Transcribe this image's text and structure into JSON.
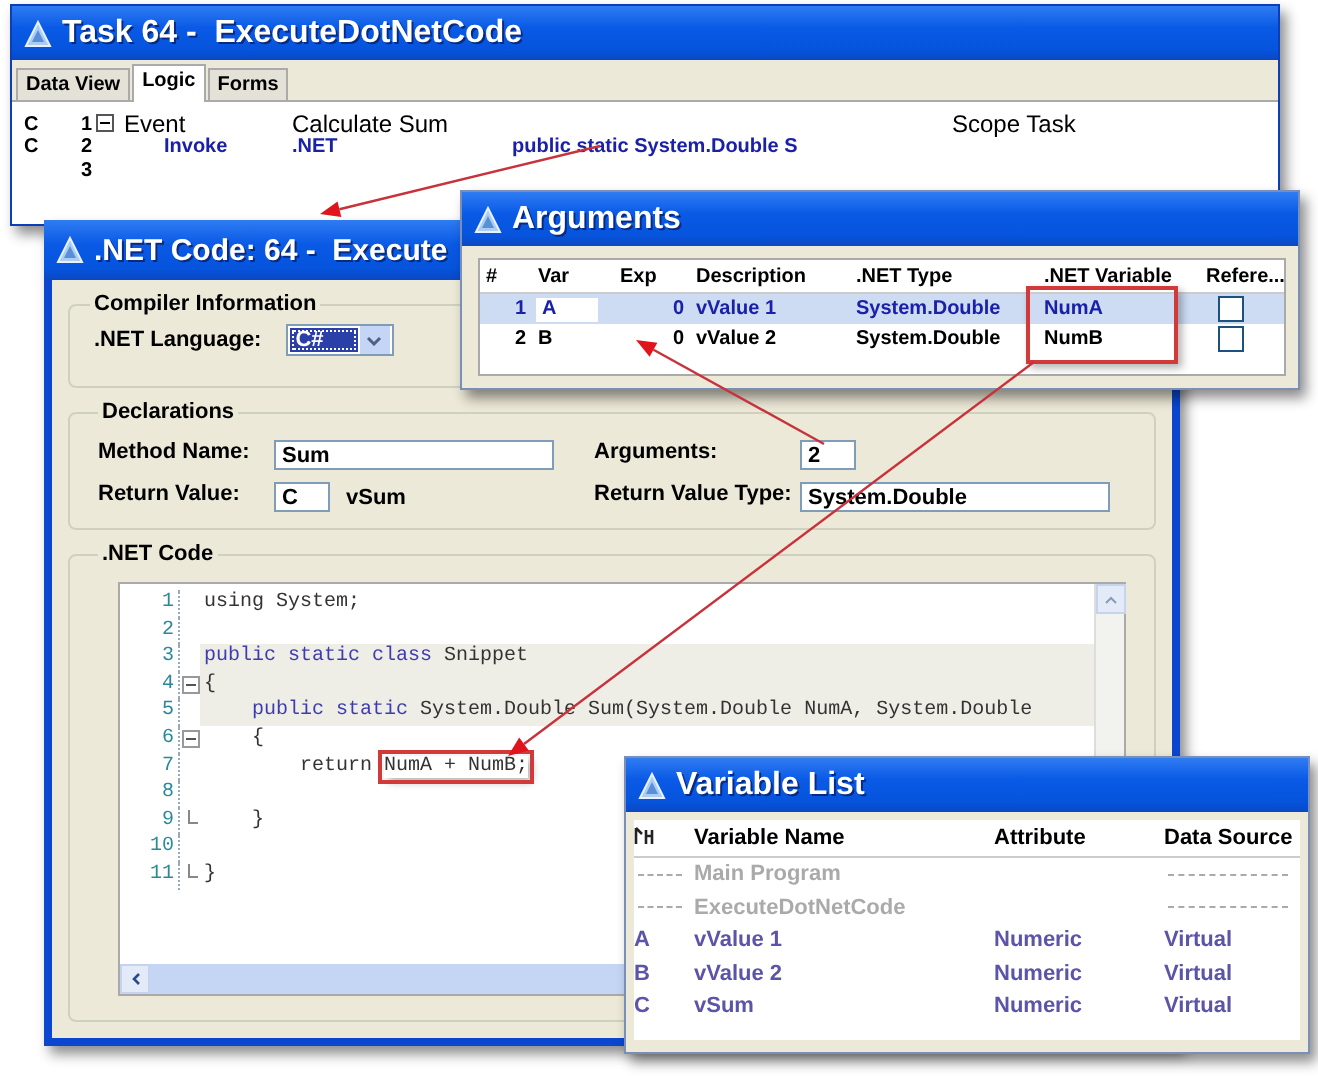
{
  "task_window": {
    "title": "Task 64 -  ExecuteDotNetCode",
    "tabs": [
      {
        "label": "Data View",
        "selected": false
      },
      {
        "label": "Logic",
        "selected": true
      },
      {
        "label": "Forms",
        "selected": false
      }
    ],
    "rows": [
      {
        "kind": "event",
        "marker": "C",
        "number": "1",
        "expanded": true,
        "col_1": "Event",
        "col_2": "Calculate Sum",
        "col_3": "Scope Task"
      },
      {
        "kind": "operation",
        "marker": "C",
        "number": "2",
        "col_1": "Invoke",
        "col_2": ".NET",
        "col_3": "public static System.Double S"
      },
      {
        "kind": "empty",
        "number": "3"
      }
    ]
  },
  "net_code_window": {
    "title": ".NET Code: 64 -  Execute",
    "compiler": {
      "title": "Compiler Information",
      "language_label": ".NET Language:",
      "language": "C#"
    },
    "declarations": {
      "title": "Declarations",
      "method_name_label": "Method Name:",
      "method_name": "Sum",
      "return_value_label": "Return Value:",
      "return_value_var": "C",
      "return_value_name": "vSum",
      "arguments_label": "Arguments:",
      "arguments": "2",
      "return_type_label": "Return Value Type:",
      "return_type": "System.Double"
    },
    "code": {
      "title": ".NET Code",
      "lines": [
        {
          "number": "1",
          "highlighted": false,
          "collapsible": false,
          "block_end": false,
          "tokens": [
            {
              "kind": "plain",
              "text": "using System;"
            }
          ]
        },
        {
          "number": "2",
          "highlighted": false,
          "collapsible": false,
          "block_end": false
        },
        {
          "number": "3",
          "highlighted": true,
          "collapsible": false,
          "block_end": false,
          "tokens": [
            {
              "kind": "keyword",
              "text": "public static class"
            },
            {
              "kind": "plain",
              "text": " Snippet"
            }
          ]
        },
        {
          "number": "4",
          "highlighted": true,
          "collapsible": true,
          "block_end": false,
          "tokens": [
            {
              "kind": "plain",
              "text": "{"
            }
          ]
        },
        {
          "number": "5",
          "highlighted": true,
          "collapsible": false,
          "block_end": false,
          "tokens": [
            {
              "kind": "keyword",
              "text": "    public static"
            },
            {
              "kind": "plain",
              "text": " System.Double Sum(System.Double NumA, System.Double"
            }
          ]
        },
        {
          "number": "6",
          "highlighted": false,
          "collapsible": true,
          "block_end": false,
          "tokens": [
            {
              "kind": "plain",
              "text": "    {"
            }
          ]
        },
        {
          "number": "7",
          "highlighted": false,
          "collapsible": false,
          "block_end": false,
          "tokens": [
            {
              "kind": "plain",
              "text": "        return "
            },
            {
              "kind": "callout",
              "text": "NumA + NumB;"
            }
          ]
        },
        {
          "number": "8",
          "highlighted": false,
          "collapsible": false,
          "block_end": false
        },
        {
          "number": "9",
          "highlighted": false,
          "collapsible": false,
          "block_end": true,
          "tokens": [
            {
              "kind": "plain",
              "text": "    }"
            }
          ]
        },
        {
          "number": "10",
          "highlighted": false,
          "collapsible": false,
          "block_end": false
        },
        {
          "number": "11",
          "highlighted": false,
          "collapsible": false,
          "block_end": true,
          "tokens": [
            {
              "kind": "plain",
              "text": "}"
            }
          ]
        }
      ]
    }
  },
  "arguments_window": {
    "title": "Arguments",
    "columns": [
      "#",
      "Var",
      "Exp",
      "Description",
      ".NET Type",
      ".NET Variable",
      "Refere..."
    ],
    "rows": [
      {
        "number": "1",
        "var": "A",
        "exp": "0",
        "description": "vValue 1",
        "net_type": "System.Double",
        "net_variable": "NumA",
        "reference": false,
        "selected": true
      },
      {
        "number": "2",
        "var": "B",
        "exp": "0",
        "description": "vValue 2",
        "net_type": "System.Double",
        "net_variable": "NumB",
        "reference": false,
        "selected": false
      }
    ]
  },
  "variable_list_window": {
    "title": "Variable List",
    "columns": [
      "Variable Name",
      "Attribute",
      "Data Source"
    ],
    "rows": [
      {
        "kind": "group",
        "name": "Main Program"
      },
      {
        "kind": "group",
        "name": "ExecuteDotNetCode"
      },
      {
        "kind": "variable",
        "letter": "A",
        "name": "vValue 1",
        "attribute": "Numeric",
        "source": "Virtual"
      },
      {
        "kind": "variable",
        "letter": "B",
        "name": "vValue 2",
        "attribute": "Numeric",
        "source": "Virtual"
      },
      {
        "kind": "variable",
        "letter": "C",
        "name": "vSum",
        "attribute": "Numeric",
        "source": "Virtual"
      }
    ]
  }
}
